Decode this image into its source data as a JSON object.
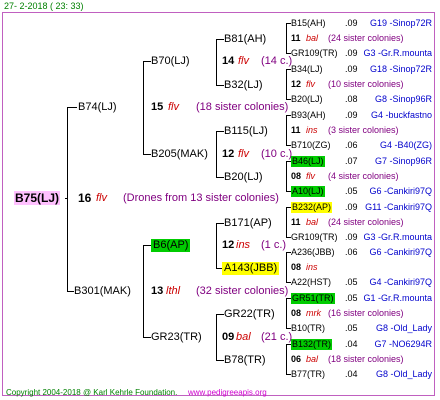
{
  "header": {
    "date": "27-  2-2018 ( 23: 33)"
  },
  "footer": {
    "copyright": "Copyright 2004-2018 @ Karl Kehrle Foundation.",
    "url": "www.pedigreeapis.org"
  },
  "root": {
    "name": "B75(LJ)",
    "num": "16",
    "race": "flv",
    "note": "(Drones from 13 sister colonies)"
  },
  "gen1": [
    {
      "name": "B74(LJ)",
      "num": "15",
      "race": "flv",
      "note": "(18 sister colonies)"
    },
    {
      "name": "B301(MAK)",
      "num": "13",
      "race": "lthl",
      "note": "(32 sister colonies)"
    }
  ],
  "gen2": [
    {
      "name": "B70(LJ)",
      "num": "14",
      "race": "flv",
      "note": "(14 c.)"
    },
    {
      "name": "B205(MAK)",
      "num": "12",
      "race": "flv",
      "note": "(10 c.)"
    },
    {
      "name": "B6(AP)",
      "num": "12",
      "race": "ins",
      "note": "(1 c.)"
    },
    {
      "name": "GR23(TR)",
      "num": "09",
      "race": "bal",
      "note": "(21 c.)"
    }
  ],
  "gen3": [
    "B81(AH)",
    "B32(LJ)",
    "B115(LJ)",
    "B20(LJ)",
    "B171(AP)",
    "A143(JBB)",
    "GR22(TR)",
    "B78(TR)"
  ],
  "gen4": [
    {
      "name": "B15(AH)",
      "val": ".09",
      "src": "G19 -Sinop72R"
    },
    {
      "num": "11",
      "race": "bal",
      "note": "(24 sister colonies)"
    },
    {
      "name": "GR109(TR)",
      "val": ".09",
      "src": "G3 -Gr.R.mounta"
    },
    {
      "name": "B34(LJ)",
      "val": ".09",
      "src": "G18 -Sinop72R"
    },
    {
      "num": "12",
      "race": "flv",
      "note": "(10 sister colonies)"
    },
    {
      "name": "B20(LJ)",
      "val": ".08",
      "src": "G8 -Sinop96R"
    },
    {
      "name": "B93(AH)",
      "val": ".09",
      "src": "G4 -buckfastno"
    },
    {
      "num": "11",
      "race": "ins",
      "note": "(3 sister colonies)"
    },
    {
      "name": "B710(ZG)",
      "val": ".06",
      "src": "G4 -B40(ZG)"
    },
    {
      "name": "B46(LJ)",
      "val": ".07",
      "src": "G7 -Sinop96R"
    },
    {
      "num": "08",
      "race": "flv",
      "note": "(4 sister colonies)"
    },
    {
      "name": "A10(LJ)",
      "val": ".05",
      "src": "G6 -Cankiri97Q"
    },
    {
      "name": "B232(AP)",
      "val": ".09",
      "src": "G11 -Cankiri97Q"
    },
    {
      "num": "11",
      "race": "bal",
      "note": "(24 sister colonies)"
    },
    {
      "name": "GR109(TR)",
      "val": ".09",
      "src": "G3 -Gr.R.mounta"
    },
    {
      "name": "A236(JBB)",
      "val": ".06",
      "src": "G6 -Cankiri97Q"
    },
    {
      "num": "08",
      "race": "ins",
      "note": ""
    },
    {
      "name": "A22(HST)",
      "val": ".05",
      "src": "G4 -Cankiri97Q"
    },
    {
      "name": "GR51(TR)",
      "val": ".05",
      "src": "G1 -Gr.R.mounta"
    },
    {
      "num": "08",
      "race": "mrk",
      "note": "(16 sister colonies)"
    },
    {
      "name": "B10(TR)",
      "val": ".05",
      "src": "G8 -Old_Lady"
    },
    {
      "name": "B132(TR)",
      "val": ".04",
      "src": "G7 -NO6294R"
    },
    {
      "num": "06",
      "race": "bal",
      "note": "(18 sister colonies)"
    },
    {
      "name": "B77(TR)",
      "val": ".04",
      "src": "G8 -Old_Lady"
    }
  ],
  "colors": {
    "border": "#c060c0",
    "root_bg": "#ffc0ff",
    "green_bg": "#00cc00",
    "yellow_bg": "#ffff00"
  }
}
